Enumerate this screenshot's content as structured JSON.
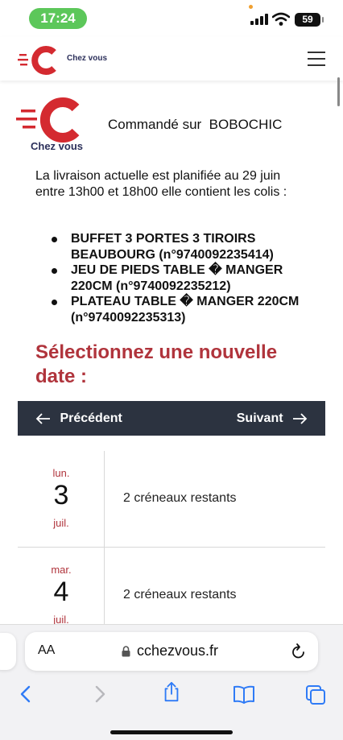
{
  "status_bar": {
    "time": "17:24",
    "battery": "59"
  },
  "header": {
    "brand": "Chez vous",
    "logo_icon": "chez-vous-logo",
    "menu_icon": "hamburger-menu-icon"
  },
  "order": {
    "brand": "Chez vous",
    "ordered_on_label": "Commandé sur",
    "shop": "BOBOCHIC",
    "delivery_text": "La livraison actuelle est planifiée au 29 juin entre 13h00 et 18h00 elle contient les colis :",
    "parcels": [
      "BUFFET 3 PORTES 3 TIROIRS BEAUBOURG (n°9740092235414)",
      "JEU DE PIEDS TABLE � MANGER 220CM (n°9740092235212)",
      "PLATEAU TABLE � MANGER 220CM (n°9740092235313)"
    ]
  },
  "date_picker": {
    "title": "Sélectionnez une nouvelle date :",
    "prev_label": "Précédent",
    "next_label": "Suivant",
    "days": [
      {
        "day_name": "lun.",
        "day_num": "3",
        "month": "juil.",
        "slots": "2 créneaux restants"
      },
      {
        "day_name": "mar.",
        "day_num": "4",
        "month": "juil.",
        "slots": "2 créneaux restants"
      }
    ]
  },
  "browser": {
    "aa_label": "AA",
    "url": "cchezvous.fr",
    "icons": [
      "back-icon",
      "forward-icon",
      "share-icon",
      "bookmarks-icon",
      "tabs-icon"
    ]
  },
  "colors": {
    "brand_red": "#d42a30",
    "brand_navy": "#2b2f5a",
    "title_red": "#b0343c",
    "nav_bar_bg": "#2c3340",
    "time_pill_green": "#5cc75a"
  }
}
